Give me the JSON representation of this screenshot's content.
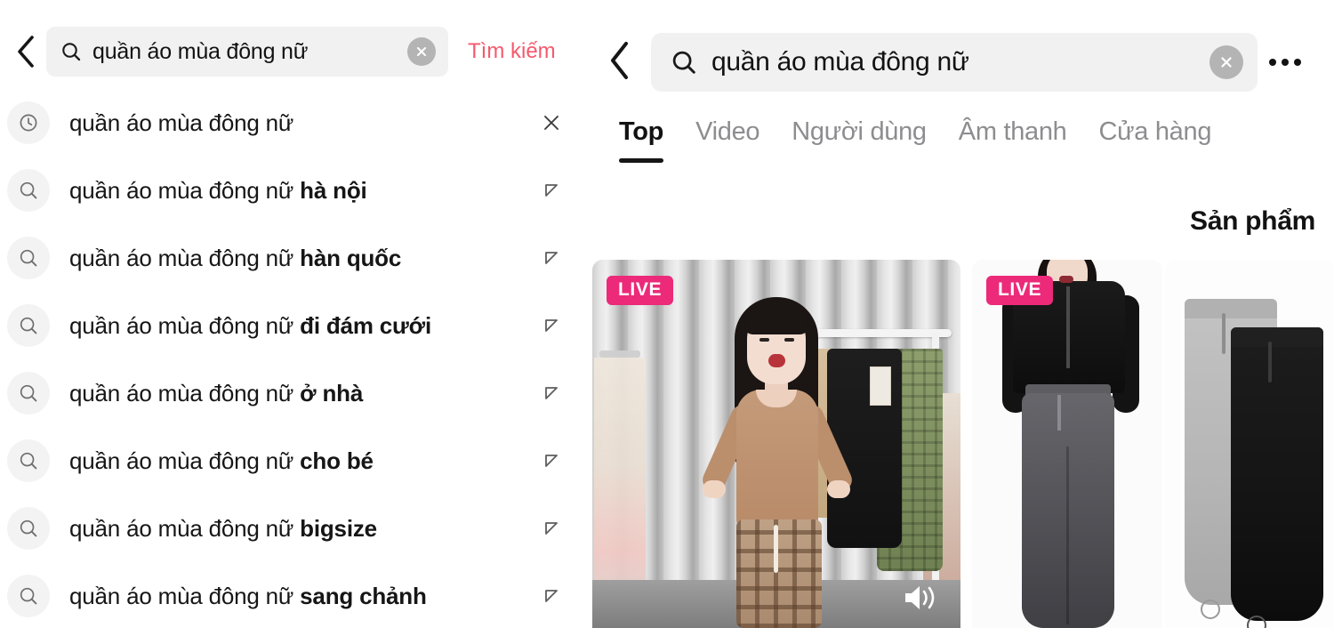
{
  "left_panel": {
    "back_icon": "chevron-left-icon",
    "search": {
      "icon": "search-icon",
      "value": "quần áo mùa đông nữ",
      "placeholder": "Tìm kiếm",
      "clear_icon": "clear-circle-icon"
    },
    "submit_label": "Tìm kiếm",
    "submit_color": "#f5596d",
    "suggestions": [
      {
        "icon": "clock-icon",
        "prefix": "quần áo mùa đông nữ",
        "bold": "",
        "trailing_icon": "close-icon"
      },
      {
        "icon": "search-icon",
        "prefix": "quần áo mùa đông nữ ",
        "bold": "hà nội",
        "trailing_icon": "arrow-up-left-icon"
      },
      {
        "icon": "search-icon",
        "prefix": "quần áo mùa đông nữ ",
        "bold": "hàn quốc",
        "trailing_icon": "arrow-up-left-icon"
      },
      {
        "icon": "search-icon",
        "prefix": "quần áo mùa đông nữ ",
        "bold": "đi đám cưới",
        "trailing_icon": "arrow-up-left-icon"
      },
      {
        "icon": "search-icon",
        "prefix": "quần áo mùa đông nữ ",
        "bold": "ở nhà",
        "trailing_icon": "arrow-up-left-icon"
      },
      {
        "icon": "search-icon",
        "prefix": "quần áo mùa đông nữ ",
        "bold": "cho bé",
        "trailing_icon": "arrow-up-left-icon"
      },
      {
        "icon": "search-icon",
        "prefix": "quần áo mùa đông nữ ",
        "bold": "bigsize",
        "trailing_icon": "arrow-up-left-icon"
      },
      {
        "icon": "search-icon",
        "prefix": "quần áo mùa đông nữ ",
        "bold": "sang chảnh",
        "trailing_icon": "arrow-up-left-icon"
      }
    ]
  },
  "right_panel": {
    "back_icon": "chevron-left-icon",
    "search": {
      "icon": "search-icon",
      "value": "quần áo mùa đông nữ",
      "placeholder": "Tìm kiếm",
      "clear_icon": "clear-circle-icon"
    },
    "more_icon": "more-horizontal-icon",
    "tabs": [
      {
        "label": "Top",
        "active": true
      },
      {
        "label": "Video",
        "active": false
      },
      {
        "label": "Người dùng",
        "active": false
      },
      {
        "label": "Âm thanh",
        "active": false
      },
      {
        "label": "Cửa hàng",
        "active": false
      }
    ],
    "section_title": "Sản phẩm",
    "live_badge_color": "#ec2a79",
    "cards": [
      {
        "live_label": "LIVE",
        "is_live": true,
        "sound_icon": "speaker-icon",
        "description": "Phiên live bán quần áo, người mẫu đứng trước giá treo đồ"
      },
      {
        "live_label": "LIVE",
        "is_live": true,
        "sound_icon": "",
        "description": "Người mẫu mặc áo khoác đen crop và quần jogger xám"
      },
      {
        "live_label": "",
        "is_live": false,
        "sound_icon": "",
        "description": "Quần jogger xám và đen trên nền trắng"
      }
    ]
  }
}
